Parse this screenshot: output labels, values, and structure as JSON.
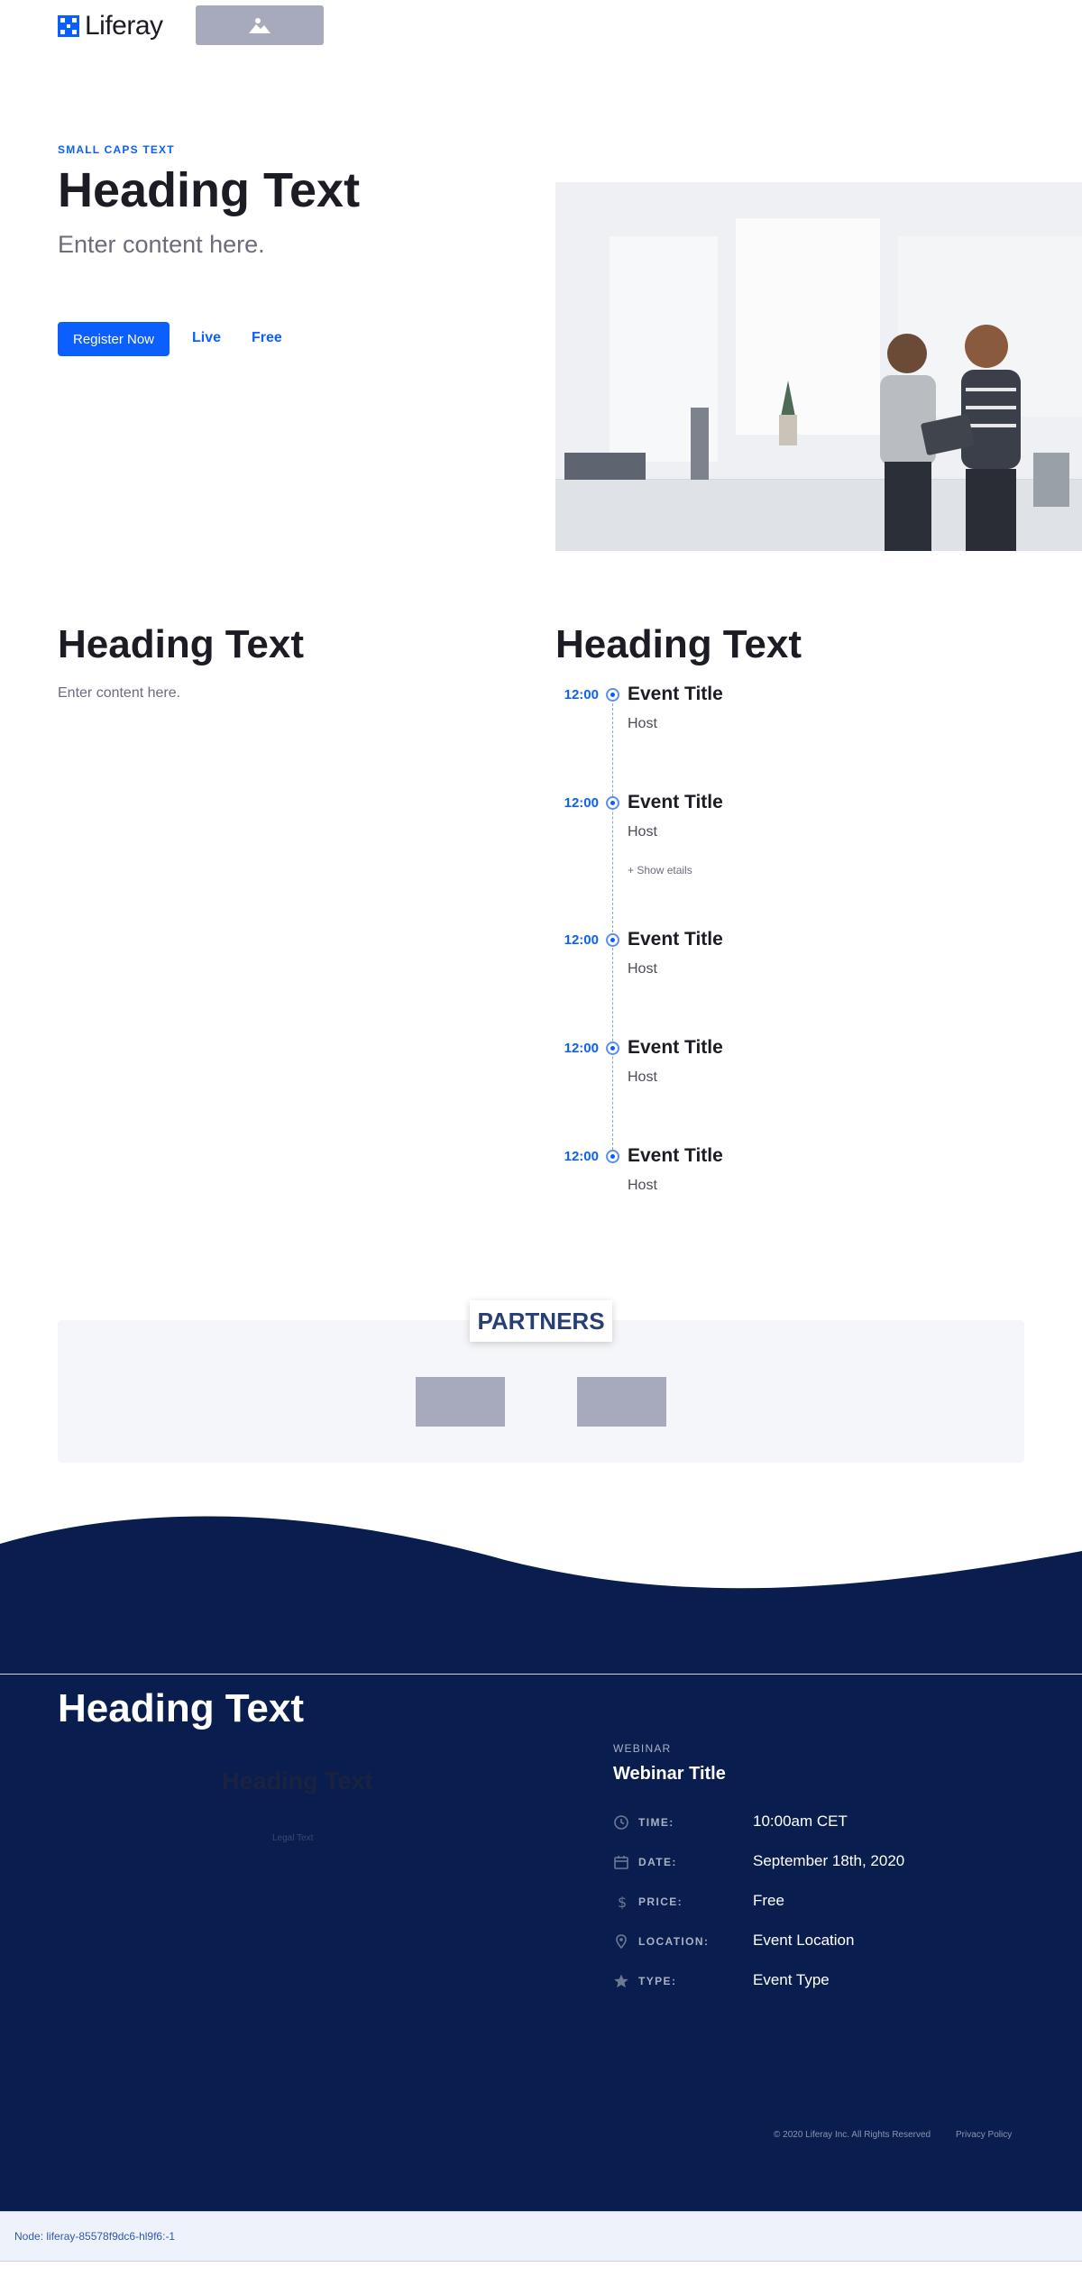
{
  "header": {
    "logo_text": "Liferay",
    "image_placeholder_icon": "image-icon"
  },
  "hero": {
    "small_caps": "SMALL CAPS TEXT",
    "heading": "Heading Text",
    "subtitle": "Enter content here.",
    "register_label": "Register Now",
    "live_label": "Live",
    "free_label": "Free"
  },
  "content": {
    "heading": "Heading Text",
    "text": "Enter content here."
  },
  "agenda": {
    "heading": "Heading Text",
    "events": [
      {
        "time": "12:00",
        "title": "Event Title",
        "host": "Host"
      },
      {
        "time": "12:00",
        "title": "Event Title",
        "host": "Host",
        "show_details": "+ Show etails"
      },
      {
        "time": "12:00",
        "title": "Event Title",
        "host": "Host"
      },
      {
        "time": "12:00",
        "title": "Event Title",
        "host": "Host"
      },
      {
        "time": "12:00",
        "title": "Event Title",
        "host": "Host"
      }
    ]
  },
  "partners": {
    "label": "PARTNERS"
  },
  "footer": {
    "heading": "Heading Text",
    "faint_heading": "Heading Text",
    "faint_legal": "Legal Text",
    "webinar": {
      "type": "WEBINAR",
      "title": "Webinar Title",
      "rows": [
        {
          "icon": "clock-icon",
          "label": "TIME:",
          "value": "10:00am CET"
        },
        {
          "icon": "calendar-icon",
          "label": "DATE:",
          "value": "September 18th, 2020"
        },
        {
          "icon": "dollar-icon",
          "label": "PRICE:",
          "value": "Free"
        },
        {
          "icon": "location-pin-icon",
          "label": "LOCATION:",
          "value": "Event Location"
        },
        {
          "icon": "star-icon",
          "label": "TYPE:",
          "value": "Event Type"
        }
      ]
    },
    "copyright": "© 2020 Liferay Inc. All Rights Reserved",
    "privacy_label": "Privacy Policy"
  },
  "node_bar": {
    "text": "Node: liferay-85578f9dc6-hl9f6:-1"
  },
  "colors": {
    "primary": "#0b5fff",
    "footer_bg": "#091e4f",
    "partners_label": "#283f75"
  }
}
